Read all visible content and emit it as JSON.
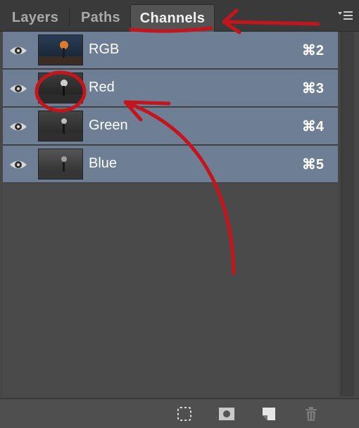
{
  "tabs": [
    {
      "label": "Layers",
      "active": false
    },
    {
      "label": "Paths",
      "active": false
    },
    {
      "label": "Channels",
      "active": true
    }
  ],
  "channels": [
    {
      "name": "RGB",
      "shortcut": "⌘2",
      "thumb": "color"
    },
    {
      "name": "Red",
      "shortcut": "⌘3",
      "thumb": "gray"
    },
    {
      "name": "Green",
      "shortcut": "⌘4",
      "thumb": "gray"
    },
    {
      "name": "Blue",
      "shortcut": "⌘5",
      "thumb": "gray"
    }
  ],
  "footer_icons": [
    "selection-icon",
    "mask-icon",
    "new-channel-icon",
    "trash-icon"
  ],
  "colors": {
    "row_bg": "#6e7f95",
    "panel_bg": "#474747",
    "annotation_red": "#c4151c"
  }
}
